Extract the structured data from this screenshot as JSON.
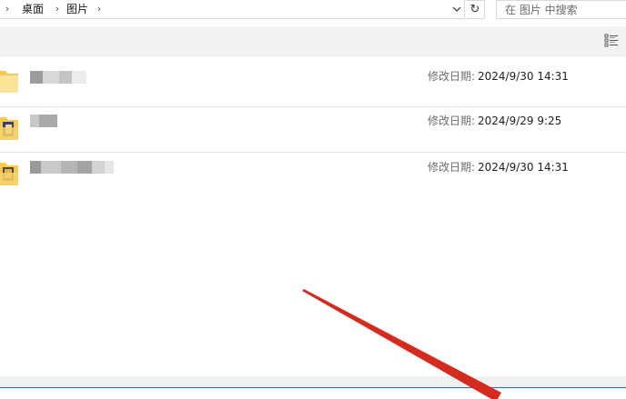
{
  "address_bar": {
    "breadcrumbs": [
      "桌面",
      "图片"
    ],
    "separator_icon": "chevron-right-icon",
    "dropdown_icon": "chevron-down-icon",
    "refresh_icon": "refresh-icon",
    "refresh_glyph": "↻"
  },
  "search": {
    "placeholder": "在 图片 中搜索"
  },
  "toolbar": {
    "view_icon": "details-view-icon"
  },
  "files": [
    {
      "name": "",
      "icon": "folder-icon",
      "date_label": "修改日期:",
      "date_value": "2024/9/30 14:31"
    },
    {
      "name": "",
      "icon": "image-folder-icon",
      "date_label": "修改日期:",
      "date_value": "2024/9/29 9:25"
    },
    {
      "name": "",
      "icon": "image-folder-icon",
      "date_label": "修改日期:",
      "date_value": "2024/9/30 14:31"
    }
  ],
  "colors": {
    "annotation_arrow": "#d42b1e",
    "selection_line": "#1f6fc4",
    "folder_yellow": "#f5c953"
  }
}
